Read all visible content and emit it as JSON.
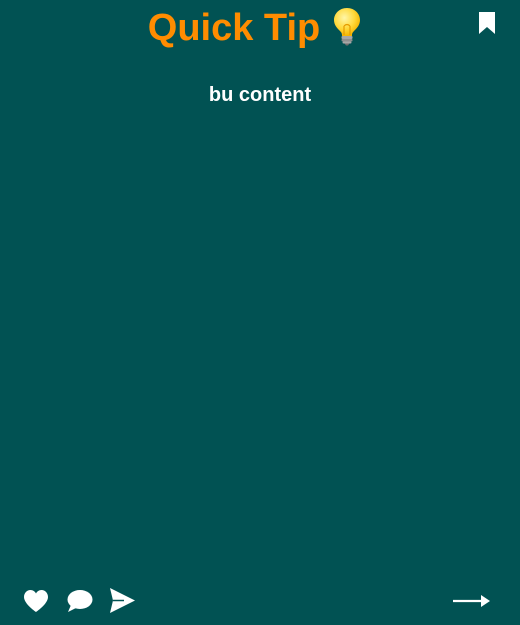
{
  "card": {
    "title": "Quick Tip",
    "title_icon": "lightbulb-icon",
    "content": "bu content"
  },
  "toolbar": {
    "bookmark_icon": "bookmark-icon",
    "like_icon": "heart-icon",
    "comment_icon": "speech-bubble-icon",
    "share_icon": "paper-plane-icon",
    "next_icon": "arrow-right-icon"
  },
  "colors": {
    "background": "#015253",
    "title": "#ff8c00",
    "text": "#ffffff"
  }
}
